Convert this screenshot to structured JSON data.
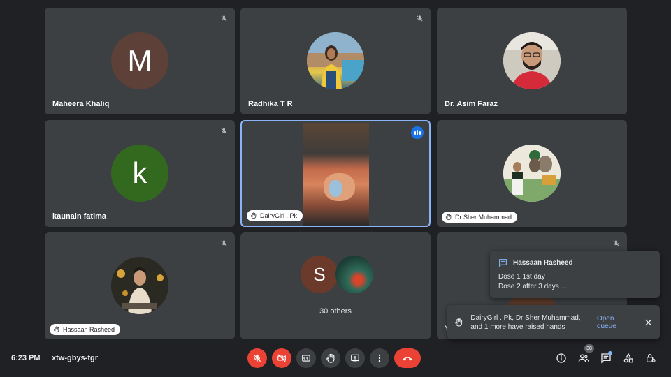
{
  "participants": {
    "maheera": {
      "name": "Maheera Khaliq",
      "initial": "M",
      "color": "#5d4037"
    },
    "radhika": {
      "name": "Radhika T R"
    },
    "asim": {
      "name": "Dr. Asim Faraz"
    },
    "kaunain": {
      "name": "kaunain fatima",
      "initial": "k",
      "color": "#33691e"
    },
    "dairygirl": {
      "name": "DairyGirl . Pk"
    },
    "sher": {
      "name": "Dr Sher Muhammad"
    },
    "hassaan": {
      "name": "Hassaan Rasheed"
    },
    "others": {
      "initial": "S",
      "label": "30 others"
    },
    "partial": {
      "name": "Y"
    }
  },
  "chat_notification": {
    "sender": "Hassaan Rasheed",
    "line1": "Dose 1 1st day",
    "line2": "Dose 2 after 3 days ..."
  },
  "raised_hands": {
    "message": "DairyGirl . Pk, Dr Sher Muhammad, and 1 more have raised hands",
    "action": "Open queue"
  },
  "bottom_bar": {
    "time": "6:23 PM",
    "meeting_code": "xtw-gbys-tgr",
    "participant_count": "38"
  },
  "colors": {
    "accent": "#8ab4f8",
    "danger": "#ea4335",
    "tile": "#3c4043",
    "background": "#202124"
  }
}
